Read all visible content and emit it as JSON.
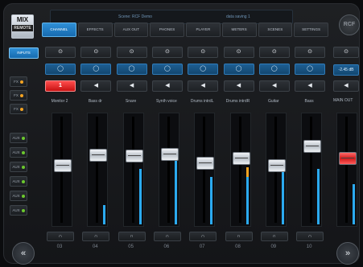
{
  "brand": {
    "logo_line1": "MIX",
    "logo_line2": "REMOTE",
    "right_logo": "RCF"
  },
  "scene_bar": {
    "left_text": "Scene: RCF Demo",
    "right_text": "data saving 1"
  },
  "tabs": [
    {
      "label": "CHANNEL",
      "active": true
    },
    {
      "label": "EFFECTS",
      "active": false
    },
    {
      "label": "AUX OUT",
      "active": false
    },
    {
      "label": "PHONES",
      "active": false
    },
    {
      "label": "PLAYER",
      "active": false
    },
    {
      "label": "METERS",
      "active": false
    },
    {
      "label": "SCENES",
      "active": false
    },
    {
      "label": "SETTINGS",
      "active": false
    }
  ],
  "left_panel": {
    "selected_label": "INPUTS",
    "fx": [
      {
        "label": "FX"
      },
      {
        "label": "FX"
      },
      {
        "label": "FX"
      }
    ],
    "aux": [
      {
        "label": "AUX"
      },
      {
        "label": "AUX"
      },
      {
        "label": "AUX"
      },
      {
        "label": "AUX"
      },
      {
        "label": "AUX"
      },
      {
        "label": "AUX"
      }
    ]
  },
  "channels": [
    {
      "name": "Monitor 2",
      "number": "03",
      "mute_label": "1",
      "fader_level": 0.55,
      "meter_level": 0.0,
      "peak": false
    },
    {
      "name": "Bass dr",
      "number": "04",
      "mute_label": "",
      "fader_level": 0.65,
      "meter_level": 0.18,
      "peak": false
    },
    {
      "name": "Snare",
      "number": "05",
      "mute_label": "",
      "fader_level": 0.64,
      "meter_level": 0.52,
      "peak": false
    },
    {
      "name": "Synth voice",
      "number": "06",
      "mute_label": "",
      "fader_level": 0.66,
      "meter_level": 0.7,
      "peak": true
    },
    {
      "name": "Drums intrdL",
      "number": "07",
      "mute_label": "",
      "fader_level": 0.57,
      "meter_level": 0.45,
      "peak": false
    },
    {
      "name": "Drums intrdR",
      "number": "08",
      "mute_label": "",
      "fader_level": 0.62,
      "meter_level": 0.54,
      "peak": true
    },
    {
      "name": "Guitar",
      "number": "09",
      "mute_label": "",
      "fader_level": 0.55,
      "meter_level": 0.58,
      "peak": true
    },
    {
      "name": "Bass",
      "number": "10",
      "mute_label": "",
      "fader_level": 0.74,
      "meter_level": 0.52,
      "peak": false
    }
  ],
  "main": {
    "label": "MAIN OUT",
    "db": "-2.45 dB",
    "fader_level": 0.62,
    "meter_level": 0.38
  },
  "strip_icons": {
    "gain": "⊙",
    "eq": "◯",
    "speaker": "◀",
    "headphone": "∩"
  },
  "nav": {
    "left": "«",
    "right": "»"
  },
  "colors": {
    "accent_blue": "#1d7ac4",
    "meter_blue": "#2baaf0",
    "peak_orange": "#f3a322",
    "mute_red": "#e12020"
  }
}
